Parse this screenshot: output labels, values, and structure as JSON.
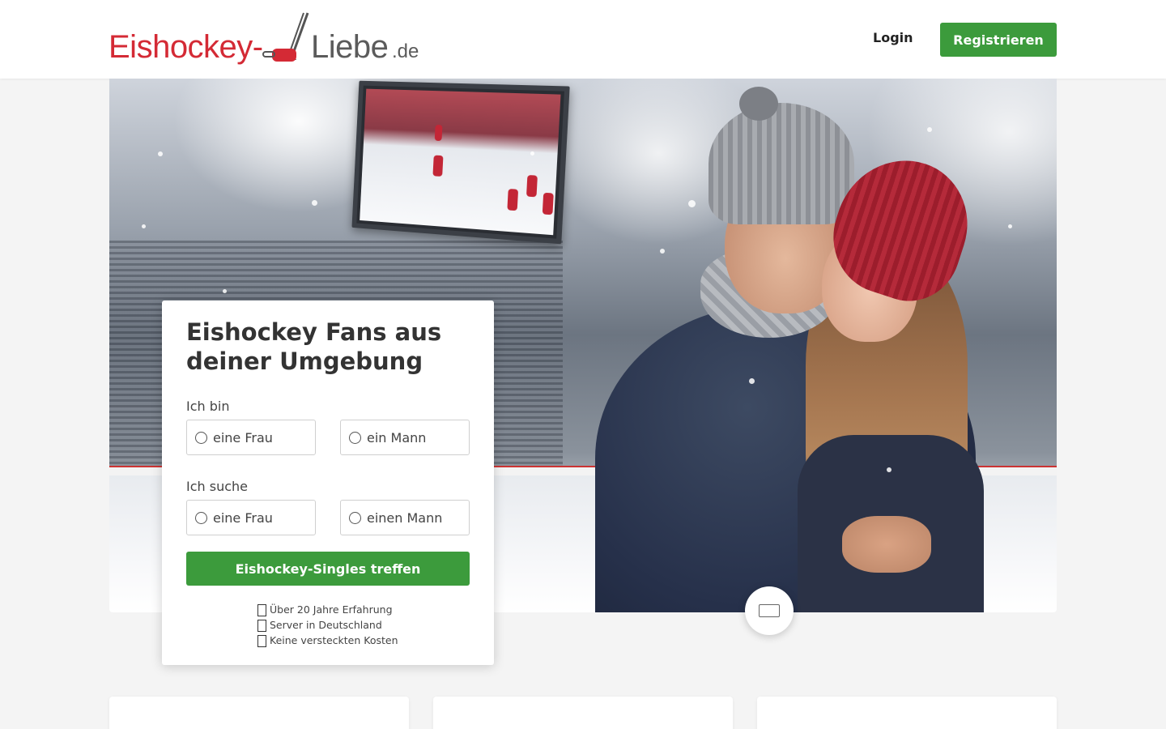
{
  "header": {
    "logo": {
      "part1": "Eishockey-",
      "part2": "Liebe",
      "tld": ".de"
    },
    "login_label": "Login",
    "register_label": "Registrieren"
  },
  "form": {
    "title": "Eishockey Fans aus deiner Umgebung",
    "i_am_label": "Ich bin",
    "i_am_options": [
      "eine Frau",
      "ein Mann"
    ],
    "seeking_label": "Ich suche",
    "seeking_options": [
      "eine Frau",
      "einen Mann"
    ],
    "submit_label": "Eishockey-Singles treffen",
    "usps": [
      "Über 20 Jahre Erfahrung",
      "Server in Deutschland",
      "Keine versteckten Kosten"
    ]
  },
  "colors": {
    "brand_red": "#d42a35",
    "cta_green": "#3c9b3c",
    "logo_grey": "#5b5b5b"
  },
  "icons": {
    "media_button": "video-icon",
    "usp_icon": "missing-glyph-icon"
  }
}
